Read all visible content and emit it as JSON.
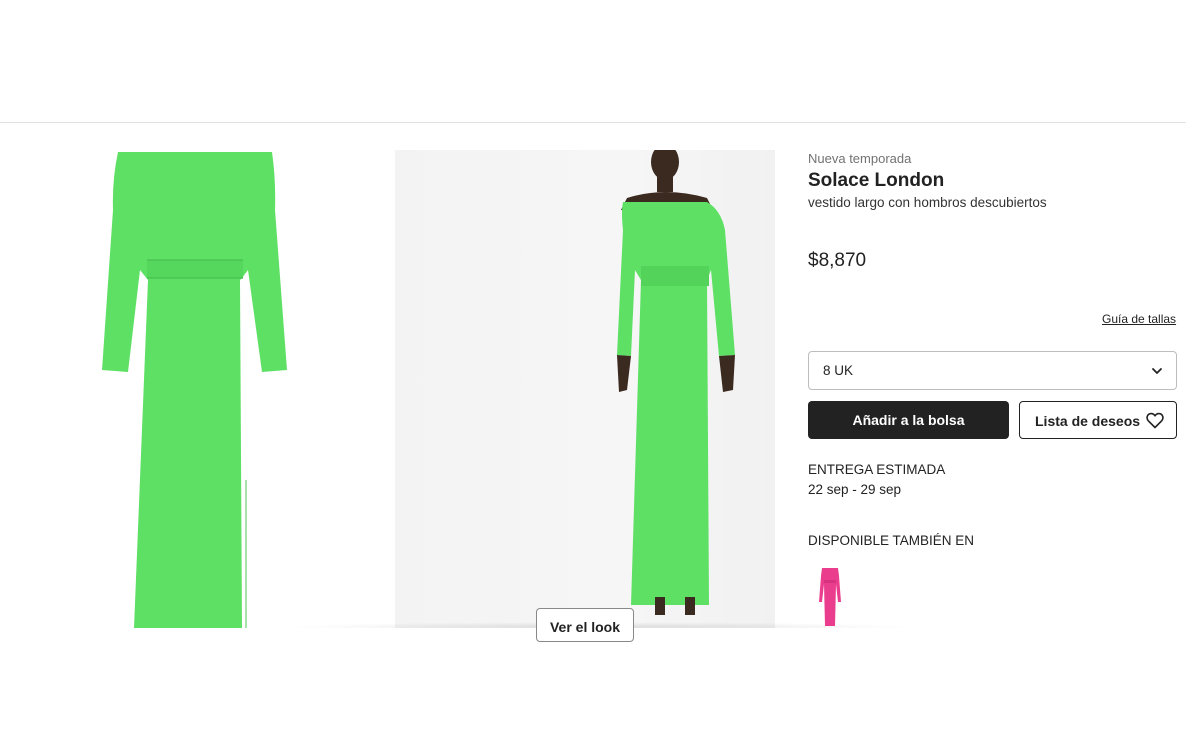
{
  "product": {
    "season_tag": "Nueva temporada",
    "brand": "Solace London",
    "description": "vestido largo con hombros descubiertos",
    "price": "$8,870"
  },
  "size": {
    "guide_link": "Guía de tallas",
    "selected": "8 UK"
  },
  "actions": {
    "add_to_bag": "Añadir a la bolsa",
    "wishlist": "Lista de deseos"
  },
  "delivery": {
    "title": "ENTREGA ESTIMADA",
    "dates": "22 sep - 29 sep"
  },
  "also_available": {
    "title": "DISPONIBLE TAMBIÉN EN"
  },
  "gallery": {
    "look_button": "Ver el look"
  },
  "colors": {
    "dress_green": "#5ee065",
    "swatch_pink": "#ea3d8d",
    "button_dark": "#222222"
  },
  "icons": [
    "chevron-down-icon",
    "heart-icon"
  ]
}
